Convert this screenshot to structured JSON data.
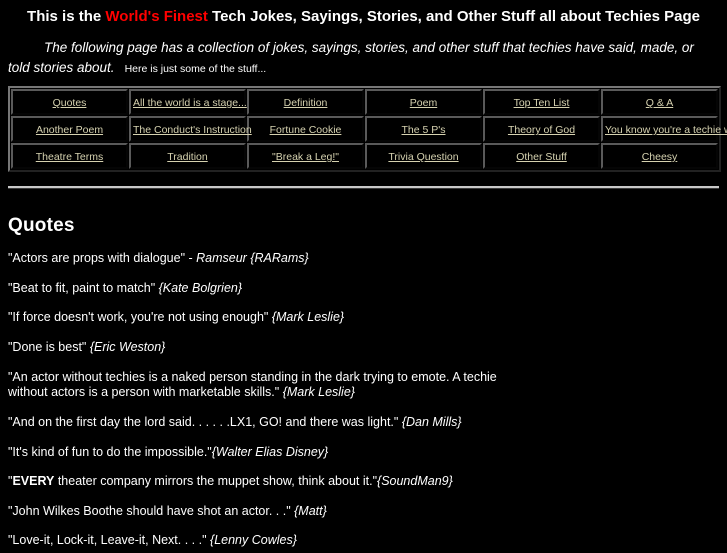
{
  "header": {
    "title_pre": "This is the ",
    "title_accent": "World's Finest",
    "title_post": " Tech Jokes, Sayings, Stories, and Other Stuff all about Techies Page",
    "accent_color": "#ff0000"
  },
  "intro": {
    "main": "The following page has a collection of jokes, sayings, stories, and other stuff that techies have said, made, or told stories about.",
    "small": "Here is just some of the stuff..."
  },
  "nav": {
    "link_color": "#d6d2b0",
    "rows": [
      [
        {
          "label": "Quotes"
        },
        {
          "label": "All the world is a stage..."
        },
        {
          "label": "Definition"
        },
        {
          "label": "Poem"
        },
        {
          "label": "Top Ten List"
        },
        {
          "label": "Q & A"
        }
      ],
      [
        {
          "label": "Another Poem"
        },
        {
          "label": "The Conduct's Instruction"
        },
        {
          "label": "Fortune Cookie"
        },
        {
          "label": "The 5 P's"
        },
        {
          "label": "Theory of God"
        },
        {
          "label": "You know you're a techie when..."
        }
      ],
      [
        {
          "label": "Theatre Terms"
        },
        {
          "label": "Tradition"
        },
        {
          "label": "\"Break a Leg!\""
        },
        {
          "label": "Trivia Question"
        },
        {
          "label": "Other Stuff"
        },
        {
          "label": "Cheesy"
        }
      ]
    ]
  },
  "quotes_section": {
    "heading": "Quotes",
    "items": [
      {
        "text": "\"Actors are props with dialogue\" - ",
        "attrib": "Ramseur {RARams}"
      },
      {
        "text": "\"Beat to fit, paint to match\" ",
        "attrib": "{Kate Bolgrien}"
      },
      {
        "text": "\"If force doesn't work, you're not using enough\" ",
        "attrib": "{Mark Leslie}"
      },
      {
        "text": "\"Done is best\" ",
        "attrib": "{Eric Weston}"
      },
      {
        "text": "\"An actor without techies is a naked person standing in the dark trying to emote. A techie without actors is a person with marketable skills.\" ",
        "attrib": "{Mark Leslie}"
      },
      {
        "text": "\"And on the first day the lord said. . . . . .LX1, GO! and there was light.\" ",
        "attrib": "{Dan Mills}"
      },
      {
        "text": "\"It's kind of fun to do the impossible.\"",
        "attrib": "{Walter Elias Disney}"
      },
      {
        "text_pre": "\"",
        "bold": "EVERY",
        "text": " theater company mirrors the muppet show, think about it.\"",
        "attrib": "{SoundMan9}"
      },
      {
        "text": "\"John Wilkes Boothe should have shot an actor. . .\" ",
        "attrib": "{Matt}"
      },
      {
        "text": "\"Love-it, Lock-it, Leave-it, Next. . . .\" ",
        "attrib": "{Lenny Cowles}"
      }
    ]
  }
}
